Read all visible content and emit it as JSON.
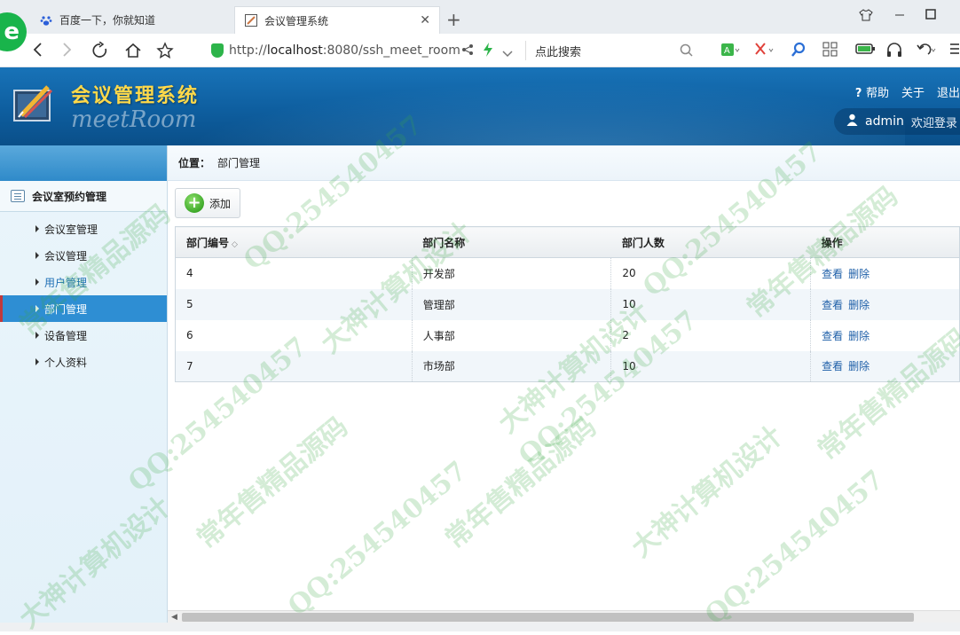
{
  "browser": {
    "tabs": [
      {
        "title": "百度一下，你就知道",
        "active": false
      },
      {
        "title": "会议管理系统",
        "active": true
      }
    ],
    "url_scheme": "http://",
    "url_host": "localhost",
    "url_rest": ":8080/ssh_meet_room",
    "search_placeholder": "点此搜索"
  },
  "app": {
    "title": "会议管理系统",
    "subtitle": "meetRoom",
    "links": {
      "help": "帮助",
      "about": "关于",
      "logout": "退出"
    },
    "user": {
      "name": "admin",
      "welcome": "欢迎登录"
    }
  },
  "sidebar": {
    "group": "会议室预约管理",
    "items": [
      {
        "label": "会议室管理",
        "state": "normal"
      },
      {
        "label": "会议管理",
        "state": "normal"
      },
      {
        "label": "用户管理",
        "state": "hover"
      },
      {
        "label": "部门管理",
        "state": "active"
      },
      {
        "label": "设备管理",
        "state": "normal"
      },
      {
        "label": "个人资料",
        "state": "normal"
      }
    ]
  },
  "breadcrumb": {
    "label": "位置：",
    "current": "部门管理"
  },
  "toolbar": {
    "add_label": "添加"
  },
  "table": {
    "columns": [
      "部门编号",
      "部门名称",
      "部门人数",
      "操作"
    ],
    "rows": [
      {
        "id": "4",
        "name": "开发部",
        "count": "20",
        "view": "查看",
        "delete": "删除"
      },
      {
        "id": "5",
        "name": "管理部",
        "count": "10",
        "view": "查看",
        "delete": "删除"
      },
      {
        "id": "6",
        "name": "人事部",
        "count": "2",
        "view": "查看",
        "delete": "删除"
      },
      {
        "id": "7",
        "name": "市场部",
        "count": "10",
        "view": "查看",
        "delete": "删除"
      }
    ]
  },
  "watermarks": [
    "QQ:254540457",
    "常年售精品源码",
    "大神计算机设计"
  ],
  "colors": {
    "header_blue": "#0e5e9f",
    "title_yellow": "#ffd94a",
    "active_nav": "#2e8ed3",
    "link_blue": "#1e5fa8"
  }
}
